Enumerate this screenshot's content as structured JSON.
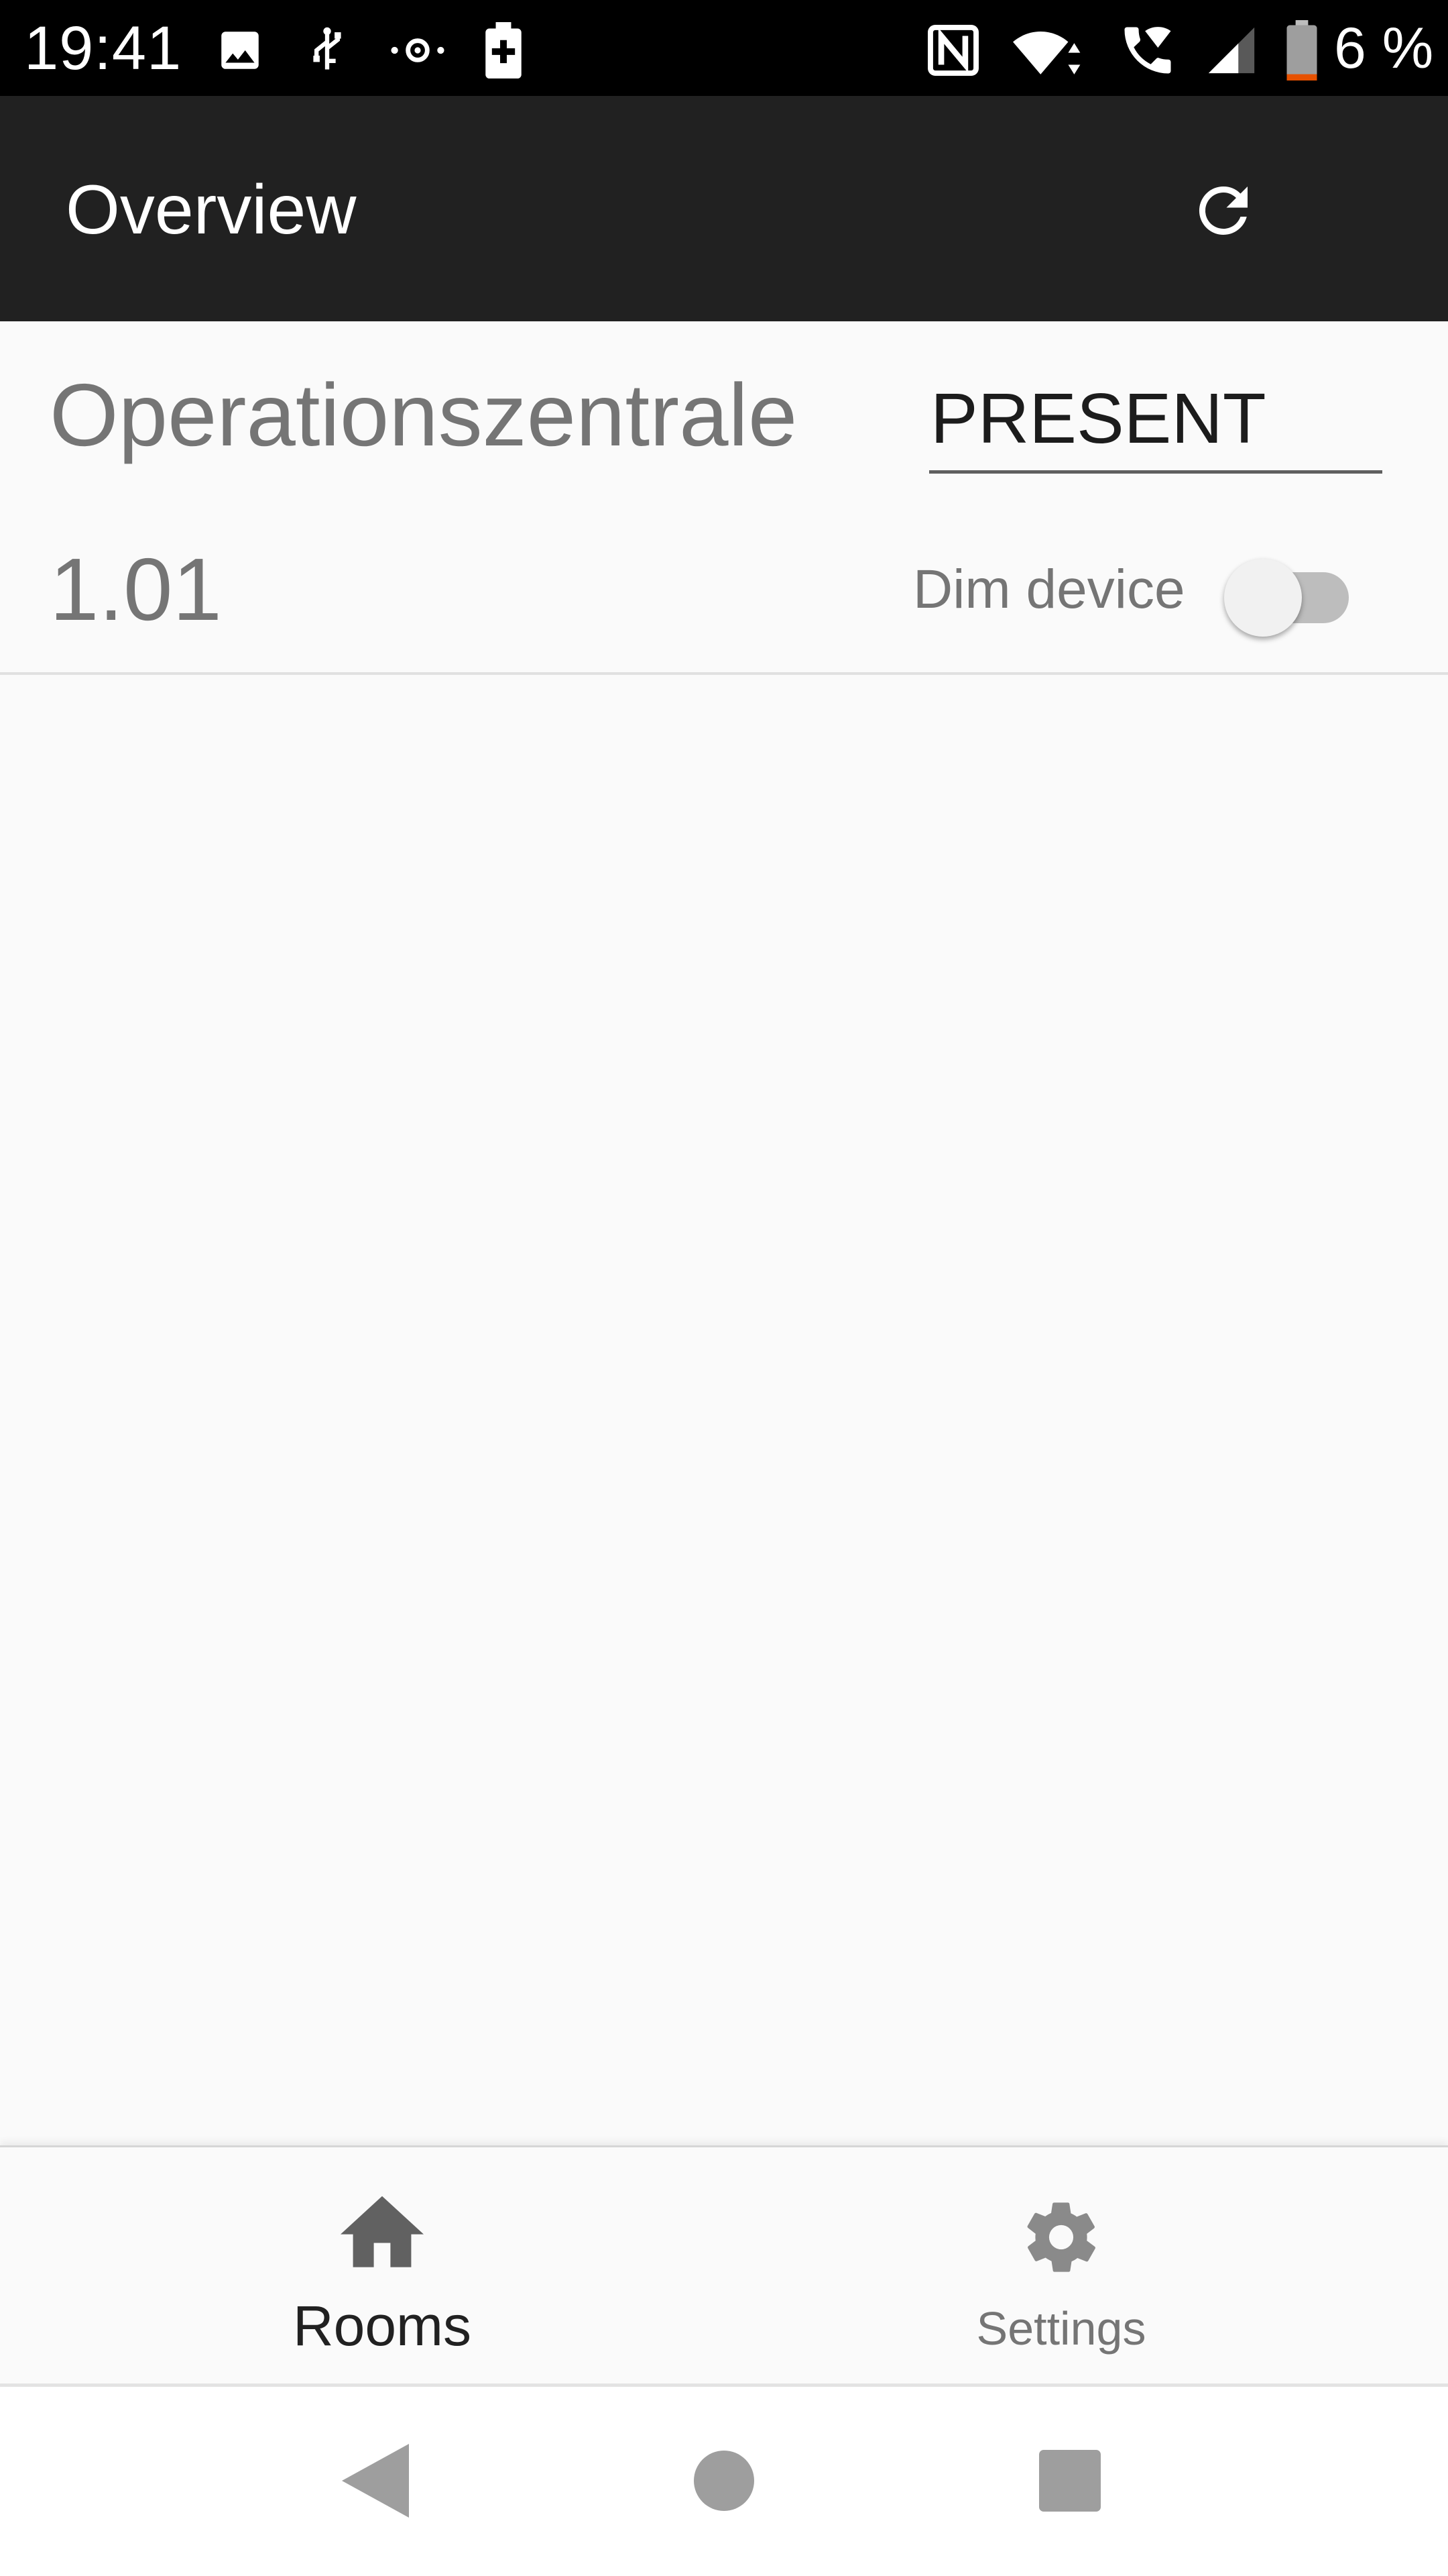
{
  "status_bar": {
    "time": "19:41",
    "battery_percent": "6 %",
    "icons": [
      "image-icon",
      "usb-icon",
      "sync-icon",
      "battery-saver-icon",
      "nfc-icon",
      "wifi-icon",
      "wifi-calling-icon",
      "cellular-signal-icon",
      "battery-icon"
    ]
  },
  "app_bar": {
    "title": "Overview",
    "refresh_icon": "refresh-icon"
  },
  "room": {
    "name": "Operationszentrale",
    "presence_value": "PRESENT",
    "number": "1.01",
    "dim_label": "Dim device",
    "dim_enabled": false
  },
  "bottom_nav": {
    "items": [
      {
        "label": "Rooms",
        "icon": "home-icon",
        "active": true
      },
      {
        "label": "Settings",
        "icon": "gear-icon",
        "active": false
      }
    ]
  },
  "system_nav": {
    "buttons": [
      "back-icon",
      "home-circle-icon",
      "recents-icon"
    ]
  },
  "colors": {
    "app_bar": "#212121",
    "status_bar": "#000000",
    "background": "#fafafa",
    "muted_text": "#757575",
    "battery_low": "#e65100"
  }
}
